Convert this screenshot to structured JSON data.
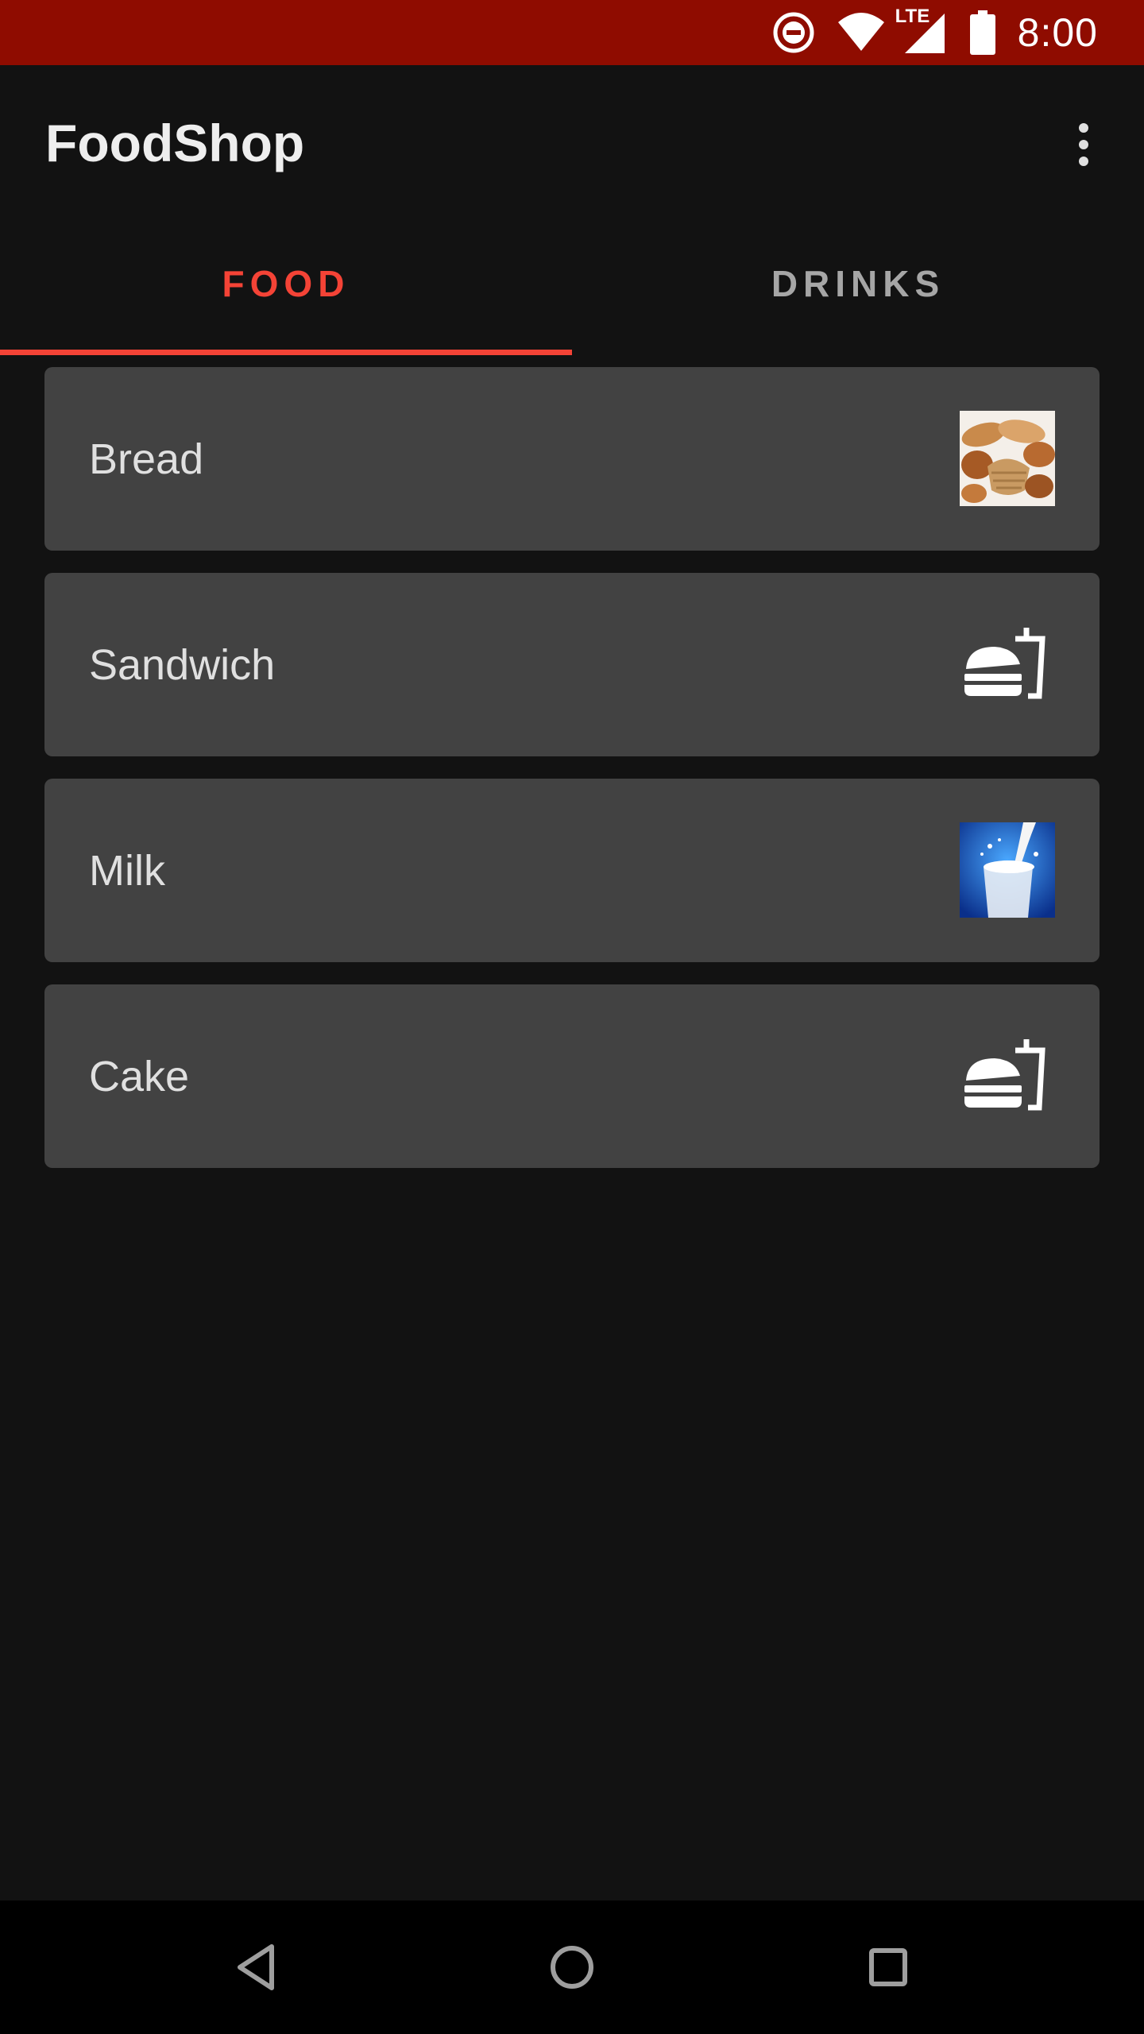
{
  "status_bar": {
    "time": "8:00",
    "network_label": "LTE",
    "icons": [
      "do-not-disturb-icon",
      "wifi-icon",
      "cellular-signal-icon",
      "battery-icon"
    ],
    "color": "#8f0c00"
  },
  "app_bar": {
    "title": "FoodShop",
    "menu_icon": "more-vert-icon"
  },
  "tabs": [
    {
      "label": "FOOD",
      "selected": true
    },
    {
      "label": "DRINKS",
      "selected": false
    }
  ],
  "items": [
    {
      "label": "Bread",
      "thumbnail": "bread-photo"
    },
    {
      "label": "Sandwich",
      "thumbnail": "fastfood-icon"
    },
    {
      "label": "Milk",
      "thumbnail": "milk-photo"
    },
    {
      "label": "Cake",
      "thumbnail": "fastfood-icon"
    }
  ],
  "nav_bar": {
    "buttons": [
      "back-icon",
      "home-icon",
      "recents-icon"
    ]
  },
  "colors": {
    "accent": "#f44336",
    "background": "#121212",
    "card": "#424242"
  }
}
